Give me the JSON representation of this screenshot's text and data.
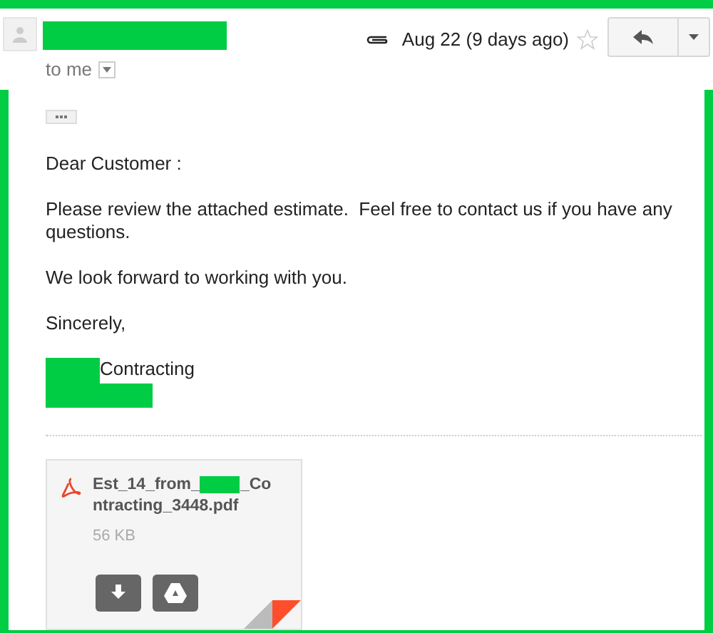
{
  "header": {
    "recipient": "to me",
    "date": "Aug 22 (9 days ago)",
    "starred": false
  },
  "body": {
    "greeting": "Dear Customer :",
    "paragraphs": [
      "Please review the attached estimate.  Feel free to contact us if you have any questions.",
      "We look forward to working with you."
    ],
    "closing": "Sincerely,",
    "signature": "Contracting"
  },
  "attachment": {
    "name_line_1_start": "Est_14_from_",
    "name_line_1_end": "_Co",
    "name_line_2": "ntracting_3448.pdf",
    "size": "56 KB"
  }
}
